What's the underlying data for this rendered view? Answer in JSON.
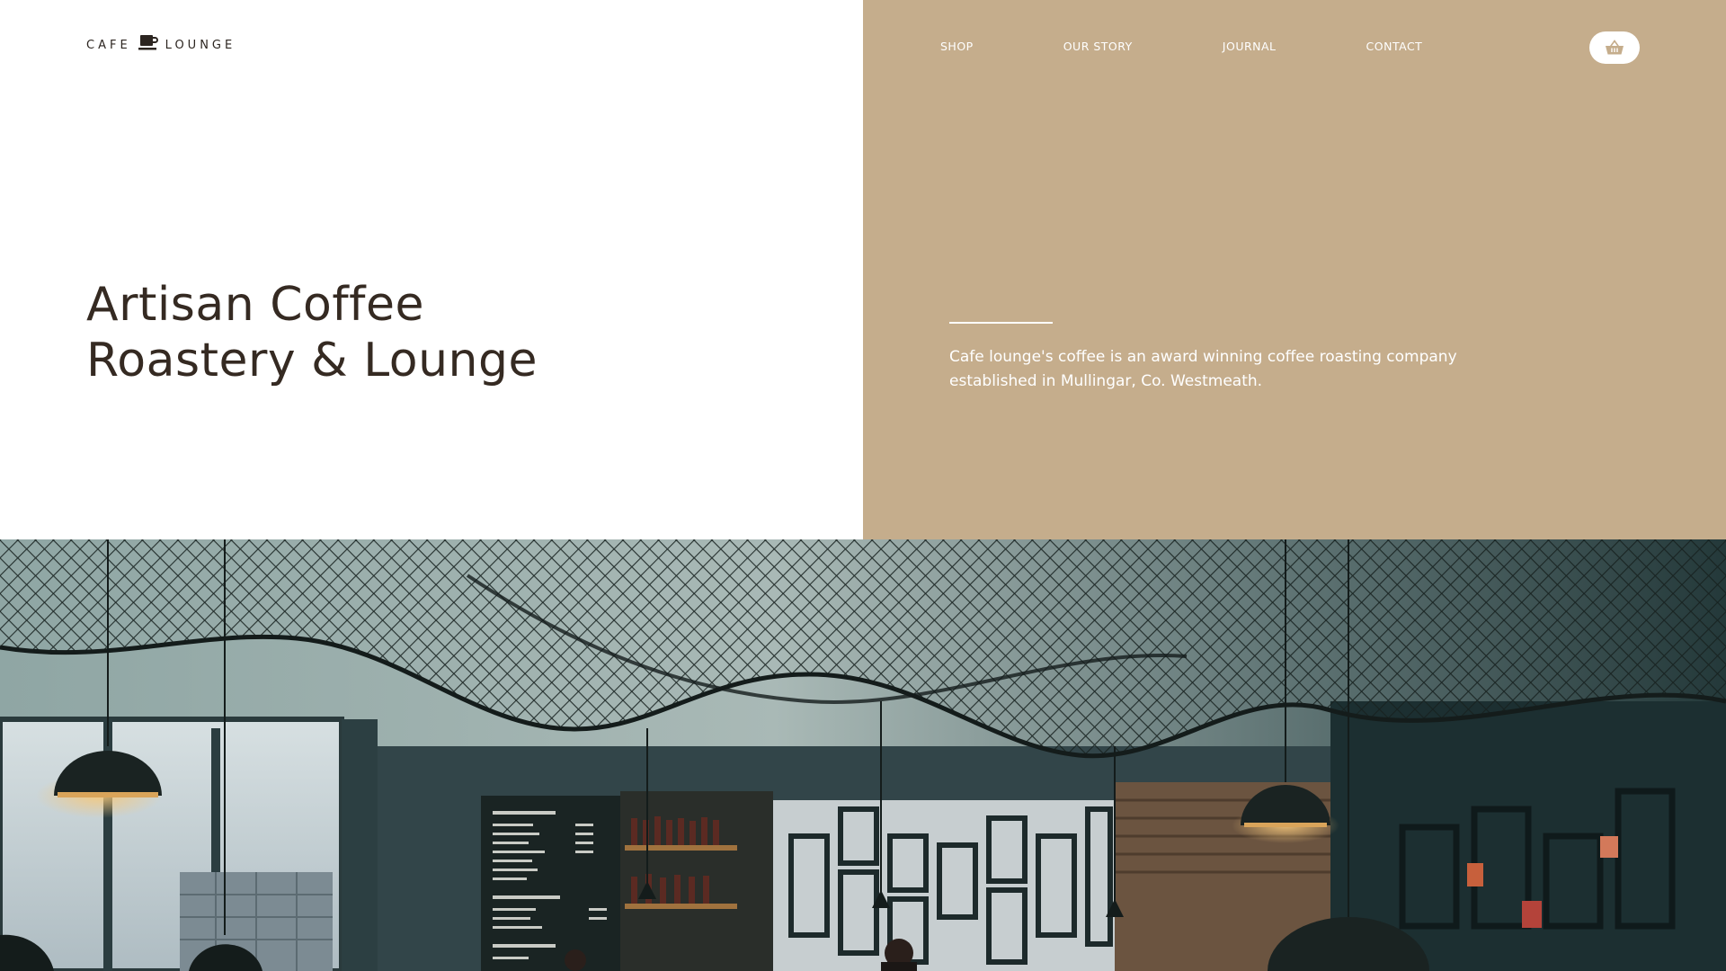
{
  "header": {
    "logo": {
      "word_left": "CAFE",
      "word_right": "LOUNGE",
      "icon": "coffee-cup-icon"
    },
    "nav": [
      {
        "label": "SHOP"
      },
      {
        "label": "OUR STORY"
      },
      {
        "label": "JOURNAL"
      },
      {
        "label": "CONTACT"
      }
    ],
    "cart": {
      "icon": "basket-icon"
    }
  },
  "hero": {
    "title_line1": "Artisan Coffee",
    "title_line2": "Roastery & Lounge",
    "description": "Cafe lounge's coffee is an award winning coffee roasting company established in Mullingar, Co. Westmeath."
  },
  "photo": {
    "subject": "cafe-interior-image"
  },
  "colors": {
    "accent_tan": "#c5ad8c",
    "heading_dark": "#352a22",
    "white": "#ffffff",
    "photo_teal": "#1f3537"
  }
}
